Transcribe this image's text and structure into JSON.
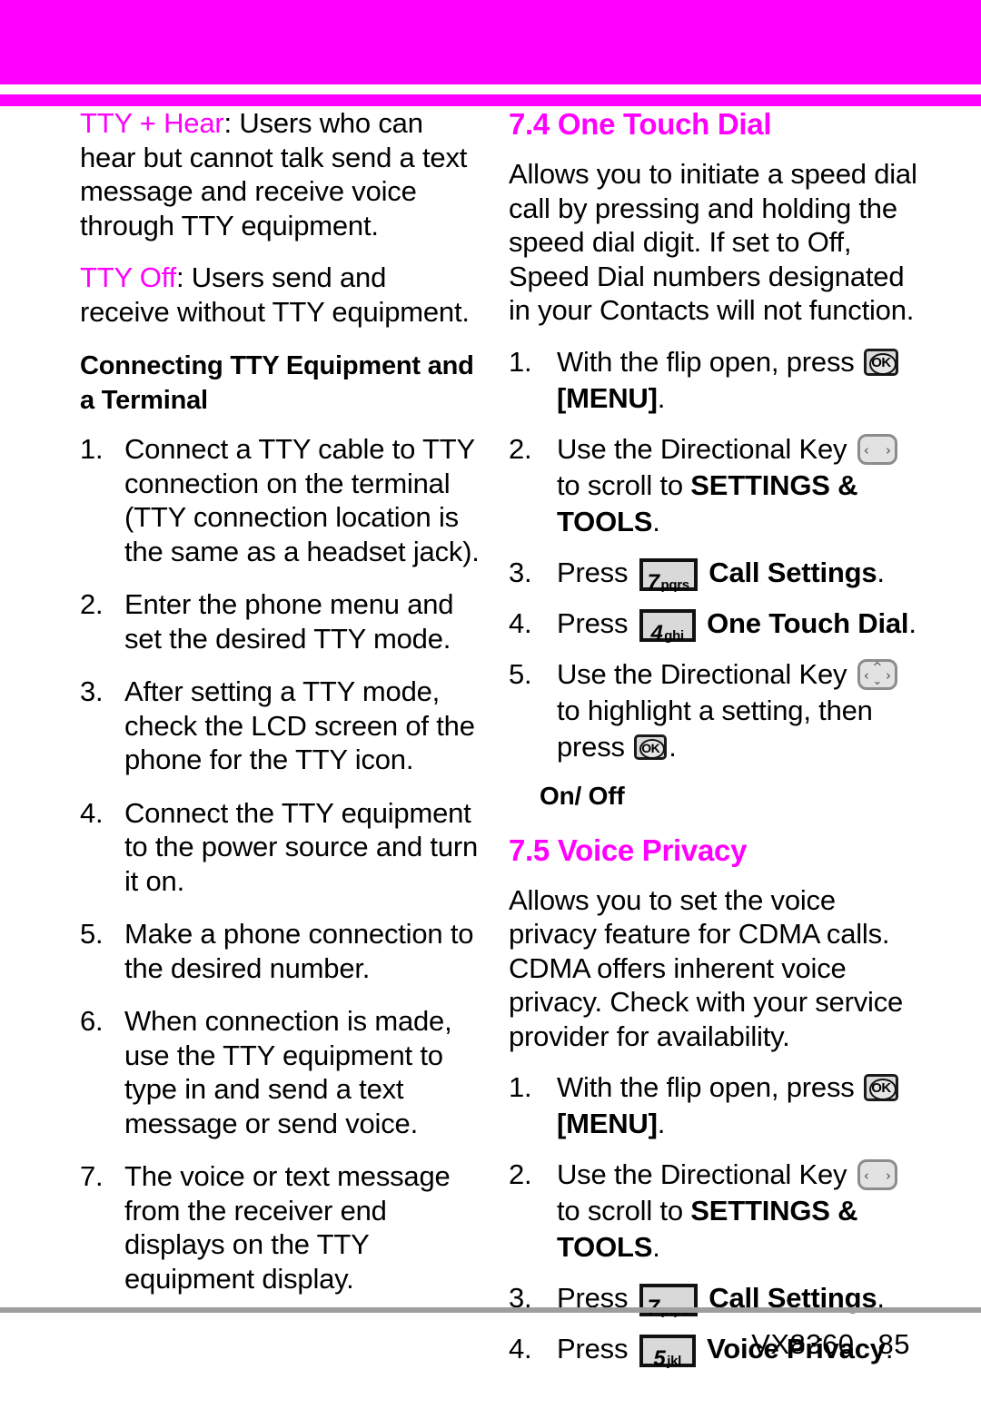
{
  "theme": {
    "accent": "#ff00ff",
    "text": "#000000",
    "rule": "#9e9e9e",
    "key_fill": "#d9d9d9",
    "key_border": "#111111",
    "dir_key_border": "#8c8c8c"
  },
  "header": {
    "band_color": "#ff00ff",
    "rule_color": "#ff00ff"
  },
  "left_column": {
    "paragraphs": [
      {
        "keyword": "TTY + Hear",
        "text": ": Users who can hear but cannot talk send a text message and receive voice through TTY equipment."
      },
      {
        "keyword": "TTY Off",
        "text": ": Users send and receive without TTY equipment."
      }
    ],
    "subheading": "Connecting TTY Equipment and a Terminal",
    "steps": [
      {
        "num": "1.",
        "text": "Connect a TTY cable to TTY connection on the terminal (TTY connection location is the same as a headset jack)."
      },
      {
        "num": "2.",
        "text": "Enter the phone menu and set the desired TTY mode."
      },
      {
        "num": "3.",
        "text": "After setting a TTY mode, check the LCD screen of the phone for the TTY icon."
      },
      {
        "num": "4.",
        "text": "Connect the TTY equipment to the power source and turn it on."
      },
      {
        "num": "5.",
        "text": "Make a phone connection to the desired number."
      },
      {
        "num": "6.",
        "text": "When connection is made, use the TTY equipment to type in and send a text message or send voice."
      },
      {
        "num": "7.",
        "text": "The voice or text message from the receiver end displays on the TTY equipment display."
      }
    ]
  },
  "right_column": {
    "section_74": {
      "heading": "7.4 One Touch Dial",
      "body": "Allows you to initiate a speed dial call by pressing and holding the speed dial digit. If set to Off, Speed Dial numbers designated in your Contacts will not function.",
      "steps": [
        {
          "num": "1.",
          "pre": "With the flip open, press",
          "key": {
            "type": "ok",
            "label": "OK"
          },
          "post": "",
          "bold_after": "[MENU]",
          "tail": "."
        },
        {
          "num": "2.",
          "pre": "Use the Directional Key",
          "key": {
            "type": "dir-lr",
            "label": "directional-key-left-right"
          },
          "post": "to scroll to",
          "bold_after": "SETTINGS & TOOLS",
          "tail": "."
        },
        {
          "num": "3.",
          "pre": "Press",
          "key": {
            "type": "num",
            "digit": "7",
            "letters": "pqrs"
          },
          "post": "",
          "bold_after": "Call Settings",
          "tail": "."
        },
        {
          "num": "4.",
          "pre": "Press",
          "key": {
            "type": "num",
            "digit": "4",
            "letters": "ghi"
          },
          "post": "",
          "bold_after": "One Touch Dial",
          "tail": "."
        },
        {
          "num": "5.",
          "pre": "Use the Directional Key",
          "key": {
            "type": "dir-4way",
            "label": "directional-key-four-way"
          },
          "post": "to highlight a setting, then press",
          "key2": {
            "type": "ok",
            "label": "OK"
          },
          "tail": "."
        }
      ],
      "minor_heading": "On/ Off"
    },
    "section_75": {
      "heading": "7.5 Voice Privacy",
      "body": "Allows you to set the voice privacy feature for CDMA calls. CDMA offers inherent voice privacy. Check with your service provider for availability.",
      "steps": [
        {
          "num": "1.",
          "pre": "With the flip open, press",
          "key": {
            "type": "ok",
            "label": "OK"
          },
          "post": "",
          "bold_after": "[MENU]",
          "tail": "."
        },
        {
          "num": "2.",
          "pre": "Use the Directional Key",
          "key": {
            "type": "dir-lr",
            "label": "directional-key-left-right"
          },
          "post": "to scroll to",
          "bold_after": "SETTINGS & TOOLS",
          "tail": "."
        },
        {
          "num": "3.",
          "pre": "Press",
          "key": {
            "type": "num",
            "digit": "7",
            "letters": "pqrs"
          },
          "post": "",
          "bold_after": "Call Settings",
          "tail": "."
        },
        {
          "num": "4.",
          "pre": "Press",
          "key": {
            "type": "num",
            "digit": "5",
            "letters": "jkl"
          },
          "post": "",
          "bold_after": "Voice Privacy",
          "tail": "."
        }
      ]
    }
  },
  "footer": {
    "model": "VX8360",
    "page_number": "85"
  }
}
